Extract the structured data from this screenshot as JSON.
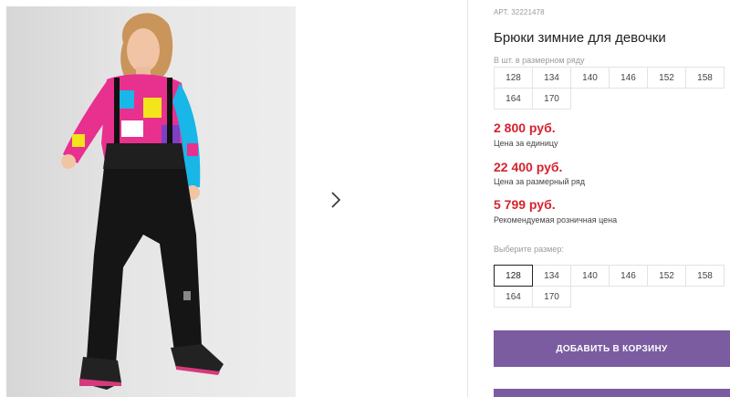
{
  "product": {
    "sku": "АРТ. 32221478",
    "title": "Брюки зимние для девочки"
  },
  "row_sizes": {
    "label": "В шт. в размерном ряду",
    "sizes": [
      "128",
      "134",
      "140",
      "146",
      "152",
      "158",
      "164",
      "170"
    ]
  },
  "prices": {
    "unit_price": "2 800 руб.",
    "unit_caption": "Цена за единицу",
    "row_price": "22 400 руб.",
    "row_caption": "Цена за размерный ряд",
    "retail_price": "5 799 руб.",
    "retail_caption": "Рекомендуемая розничная цена"
  },
  "size_picker": {
    "label": "Выберите размер:",
    "sizes": [
      "128",
      "134",
      "140",
      "146",
      "152",
      "158",
      "164",
      "170"
    ],
    "selected": "128"
  },
  "actions": {
    "add_to_cart": "ДОБАВИТЬ В КОРЗИНУ"
  },
  "gallery": {
    "next_icon": "chevron-right-icon"
  },
  "colors": {
    "accent": "#7b5ca0",
    "price": "#d6232f"
  }
}
